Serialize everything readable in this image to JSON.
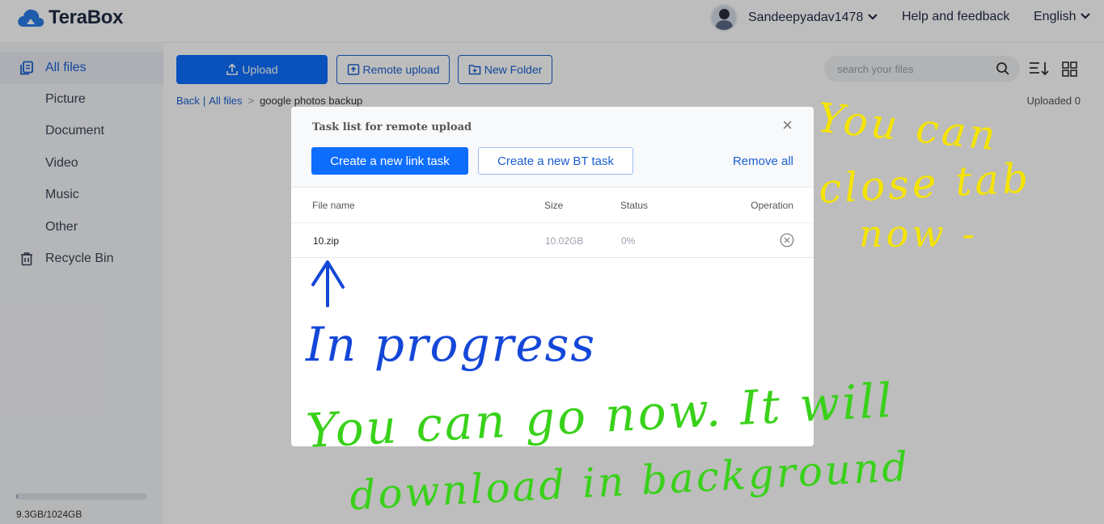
{
  "header": {
    "logo_text": "TeraBox",
    "user_name": "Sandeepyadav1478",
    "help_label": "Help and feedback",
    "language": "English"
  },
  "sidebar": {
    "items": [
      {
        "label": "All files",
        "icon": "all-files-icon"
      },
      {
        "label": "Picture"
      },
      {
        "label": "Document"
      },
      {
        "label": "Video"
      },
      {
        "label": "Music"
      },
      {
        "label": "Other"
      },
      {
        "label": "Recycle Bin",
        "icon": "trash-icon"
      }
    ],
    "storage_text": "9.3GB/1024GB",
    "storage_fraction": 0.009
  },
  "toolbar": {
    "upload_label": "Upload",
    "remote_upload_label": "Remote upload",
    "new_folder_label": "New Folder",
    "search_placeholder": "search your files"
  },
  "breadcrumb": {
    "back": "Back",
    "sep": "|",
    "all_files": "All files",
    "arrow": ">",
    "current": "google photos backup"
  },
  "uploaded_text": "Uploaded 0",
  "dialog": {
    "title": "Task list for remote upload",
    "close": "×",
    "new_link_task": "Create a new link task",
    "new_bt_task": "Create a new BT task",
    "remove_all": "Remove all",
    "columns": {
      "file_name": "File name",
      "size": "Size",
      "status": "Status",
      "operation": "Operation"
    },
    "rows": [
      {
        "name": "10.zip",
        "size": "10.02GB",
        "status": "0%"
      }
    ]
  },
  "annotations": {
    "yellow_line1": "You can",
    "yellow_line2": "close tab",
    "yellow_line3": "now -",
    "blue_text": "In progress",
    "green_line1": "You can go now. It will",
    "green_line2": "download in background",
    "colors": {
      "yellow": "#f5e400",
      "blue": "#1447d8",
      "green": "#39d11a"
    }
  }
}
